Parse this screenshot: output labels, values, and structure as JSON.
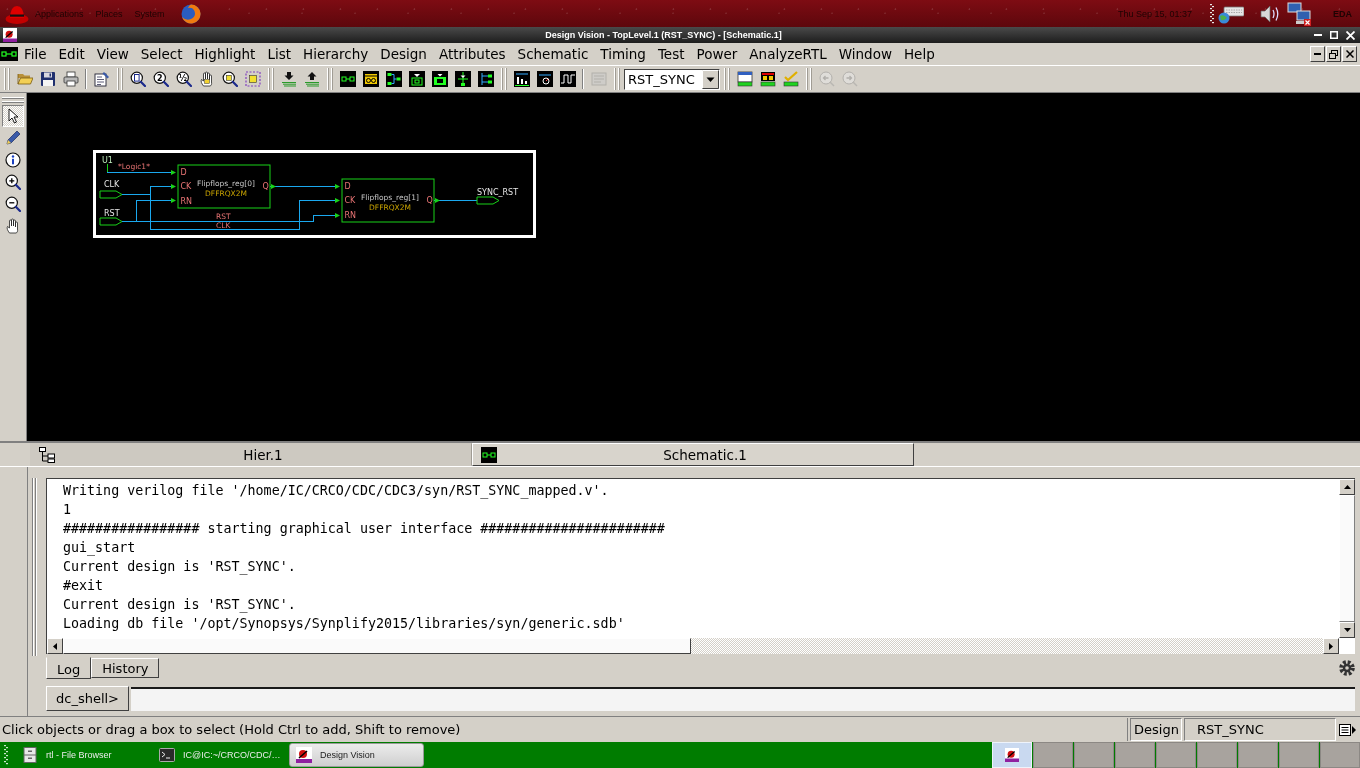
{
  "top_panel": {
    "menus": [
      "Applications",
      "Places",
      "System"
    ],
    "clock": "Thu Sep 15, 01:37",
    "user": "EDA"
  },
  "window": {
    "title": "Design Vision - TopLevel.1 (RST_SYNC) - [Schematic.1]"
  },
  "menu_bar": [
    "File",
    "Edit",
    "View",
    "Select",
    "Highlight",
    "List",
    "Hierarchy",
    "Design",
    "Attributes",
    "Schematic",
    "Timing",
    "Test",
    "Power",
    "AnalyzeRTL",
    "Window",
    "Help"
  ],
  "toolbar": [
    {
      "kind": "buttons",
      "buttons": [
        {
          "disabled": false
        },
        {
          "disabled": false
        },
        {
          "disabled": false
        }
      ]
    },
    {
      "kind": "buttons",
      "buttons": [
        {
          "disabled": false
        }
      ]
    },
    {
      "kind": "buttons",
      "buttons": [
        {
          "disabled": false
        },
        {
          "disabled": false,
          "glyph": "2"
        },
        {
          "disabled": false,
          "glyph": "½"
        },
        {
          "disabled": false
        },
        {
          "disabled": false
        },
        {
          "disabled": false
        }
      ]
    },
    {
      "kind": "buttons",
      "buttons": [
        {
          "disabled": false
        },
        {
          "disabled": false
        }
      ]
    },
    {
      "kind": "buttons",
      "buttons": [
        {
          "disabled": false
        },
        {
          "disabled": false
        },
        {
          "disabled": false
        },
        {
          "disabled": false
        },
        {
          "disabled": false
        },
        {
          "disabled": false
        },
        {
          "disabled": false
        }
      ]
    },
    {
      "kind": "buttons",
      "buttons": [
        {
          "disabled": false
        },
        {
          "disabled": false
        },
        {
          "disabled": false
        }
      ]
    },
    {
      "kind": "buttons",
      "buttons": [
        {
          "disabled": true
        }
      ]
    },
    {
      "kind": "dropdown",
      "value": "RST_SYNC"
    },
    {
      "kind": "buttons",
      "buttons": [
        {
          "disabled": false
        },
        {
          "disabled": false
        },
        {
          "disabled": false
        }
      ]
    },
    {
      "kind": "buttons",
      "buttons": [
        {
          "disabled": true
        },
        {
          "disabled": true
        }
      ]
    }
  ],
  "tools": [
    {
      "selected": true
    },
    {
      "selected": false
    },
    {
      "selected": false
    },
    {
      "selected": false
    },
    {
      "selected": false
    },
    {
      "selected": false
    }
  ],
  "schematic": {
    "tie_cell": {
      "name": "U1",
      "net": "*Logic1*"
    },
    "ports": [
      "CLK",
      "RST",
      "SYNC_RST"
    ],
    "cells": [
      {
        "name": "Flipflops_reg[0]",
        "type": "DFFRQX2M",
        "inputs": [
          "D",
          "CK",
          "RN"
        ],
        "output": "Q"
      },
      {
        "name": "Flipflops_reg[1]",
        "type": "DFFRQX2M",
        "inputs": [
          "D",
          "CK",
          "RN"
        ],
        "output": "Q"
      }
    ],
    "net_labels": [
      "RST",
      "CLK"
    ]
  },
  "view_tabs": [
    {
      "label": "Hier.1",
      "selected": false
    },
    {
      "label": "Schematic.1",
      "selected": true
    }
  ],
  "console": {
    "lines": [
      "Writing verilog file '/home/IC/CRCO/CDC/CDC3/syn/RST_SYNC_mapped.v'.",
      "1",
      "################# starting graphical user interface #######################",
      "gui_start",
      "Current design is 'RST_SYNC'.",
      "#exit",
      "Current design is 'RST_SYNC'.",
      "Loading db file '/opt/Synopsys/Synplify2015/libraries/syn/generic.sdb'"
    ],
    "tabs": [
      {
        "label": "Log",
        "selected": true
      },
      {
        "label": "History",
        "selected": false
      }
    ],
    "prompt": "dc_shell>"
  },
  "status_bar": {
    "message": "Click objects or drag a box to select (Hold Ctrl to add, Shift to remove)",
    "design_label": "Design",
    "design_value": "RST_SYNC"
  },
  "taskbar": {
    "windows": [
      {
        "title": "rtl - File Browser",
        "selected": false
      },
      {
        "title": "IC@IC:~/CRCO/CDC/…",
        "selected": false
      },
      {
        "title": "Design Vision",
        "selected": true
      }
    ],
    "workspaces": [
      {
        "selected": true
      },
      {
        "selected": false
      },
      {
        "selected": false
      },
      {
        "selected": false
      },
      {
        "selected": false
      },
      {
        "selected": false
      },
      {
        "selected": false
      },
      {
        "selected": false
      },
      {
        "selected": false
      }
    ]
  }
}
